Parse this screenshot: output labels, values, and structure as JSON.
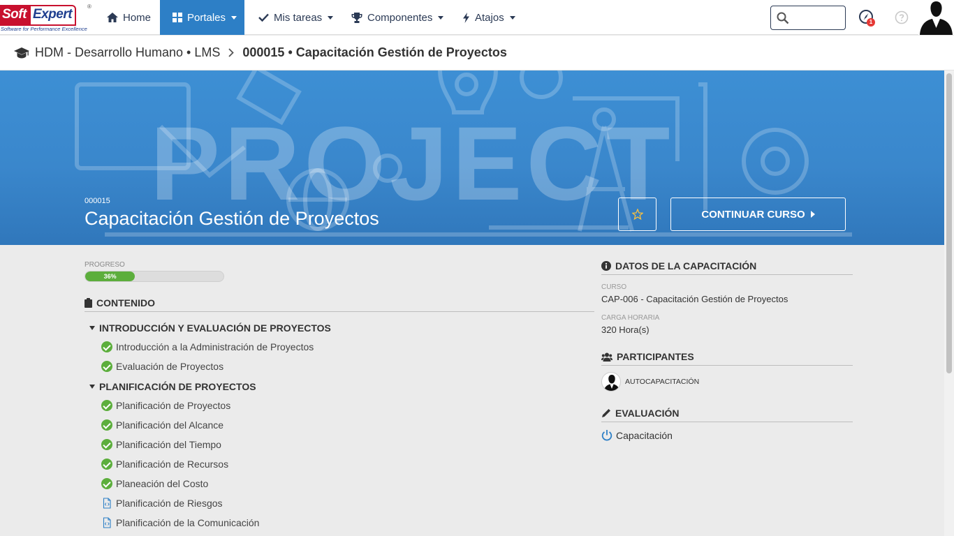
{
  "logo": {
    "soft": "Soft",
    "expert": "Expert",
    "reg": "®",
    "tagline": "Software for Performance Excellence"
  },
  "nav": {
    "home": "Home",
    "portales": "Portales",
    "tareas": "Mis tareas",
    "componentes": "Componentes",
    "atajos": "Atajos"
  },
  "search": {
    "value": "",
    "placeholder": ""
  },
  "notifications": {
    "count": "1"
  },
  "breadcrumb": {
    "parent": "HDM - Desarrollo Humano • LMS",
    "current": "000015 • Capacitación Gestión de Proyectos"
  },
  "hero": {
    "bg_word": "PROJECT",
    "code": "000015",
    "title": "Capacitación Gestión de Proyectos",
    "continue_label": "CONTINUAR CURSO"
  },
  "progress": {
    "label": "PROGRESO",
    "percent": 36,
    "text": "36%"
  },
  "content": {
    "heading": "CONTENIDO",
    "modules": [
      {
        "title": "INTRODUCCIÓN Y EVALUACIÓN DE PROYECTOS",
        "lessons": [
          {
            "title": "Introducción a la Administración de Proyectos",
            "status": "done"
          },
          {
            "title": "Evaluación de Proyectos",
            "status": "done"
          }
        ]
      },
      {
        "title": "PLANIFICACIÓN DE PROYECTOS",
        "lessons": [
          {
            "title": "Planificación de Proyectos",
            "status": "done"
          },
          {
            "title": "Planificación del Alcance",
            "status": "done"
          },
          {
            "title": "Planificación del Tiempo",
            "status": "done"
          },
          {
            "title": "Planificación de Recursos",
            "status": "done"
          },
          {
            "title": "Planeación del Costo",
            "status": "done"
          },
          {
            "title": "Planificación de Riesgos",
            "status": "pending"
          },
          {
            "title": "Planificación de la Comunicación",
            "status": "pending"
          }
        ]
      }
    ]
  },
  "details": {
    "heading": "DATOS DE LA CAPACITACIÓN",
    "curso_label": "CURSO",
    "curso_value": "CAP-006 - Capacitación Gestión de Proyectos",
    "carga_label": "CARGA HORARIA",
    "carga_value": "320 Hora(s)"
  },
  "participants": {
    "heading": "PARTICIPANTES",
    "item": "AUTOCAPACITACIÓN"
  },
  "evaluation": {
    "heading": "EVALUACIÓN",
    "item": "Capacitación"
  },
  "colors": {
    "primary": "#2d7fc6",
    "success": "#5cae3c",
    "brand_red": "#c8102e",
    "brand_blue": "#1f3f8f"
  }
}
